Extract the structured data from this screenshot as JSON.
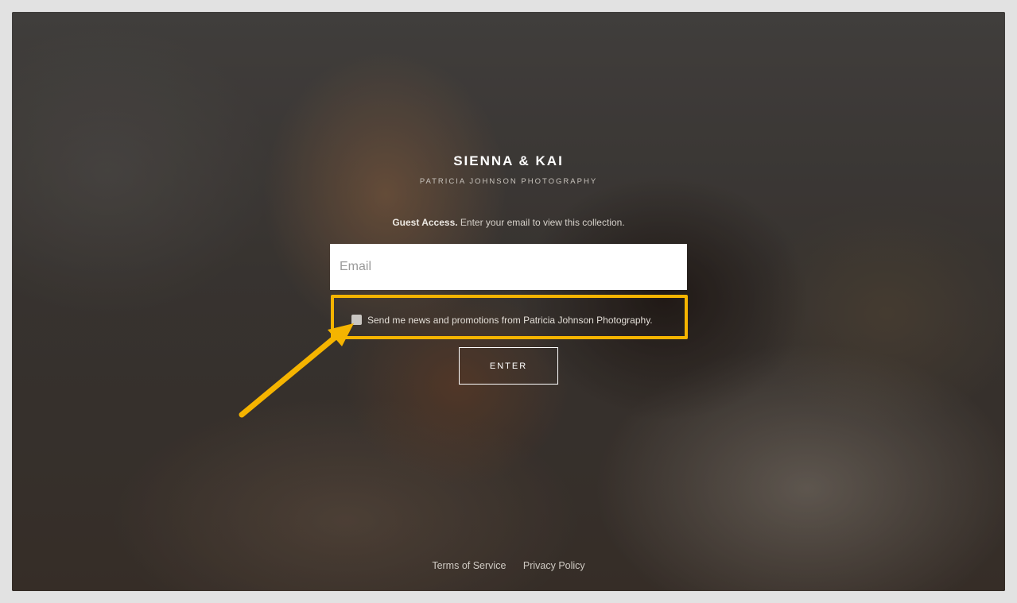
{
  "gallery": {
    "title": "SIENNA & KAI",
    "photographer": "PATRICIA JOHNSON PHOTOGRAPHY"
  },
  "guest_access": {
    "label": "Guest Access.",
    "text": " Enter your email to view this collection."
  },
  "email_field": {
    "placeholder": "Email",
    "value": ""
  },
  "consent": {
    "checked": false,
    "label": "Send me news and promotions from Patricia Johnson Photography."
  },
  "enter_button": {
    "label": "ENTER"
  },
  "footer": {
    "terms": "Terms of Service",
    "privacy": "Privacy Policy"
  },
  "colors": {
    "highlight": "#f5b400",
    "arrow": "#f5b400"
  },
  "icons": {
    "annotation": "arrow-icon",
    "consent": "checkbox"
  }
}
